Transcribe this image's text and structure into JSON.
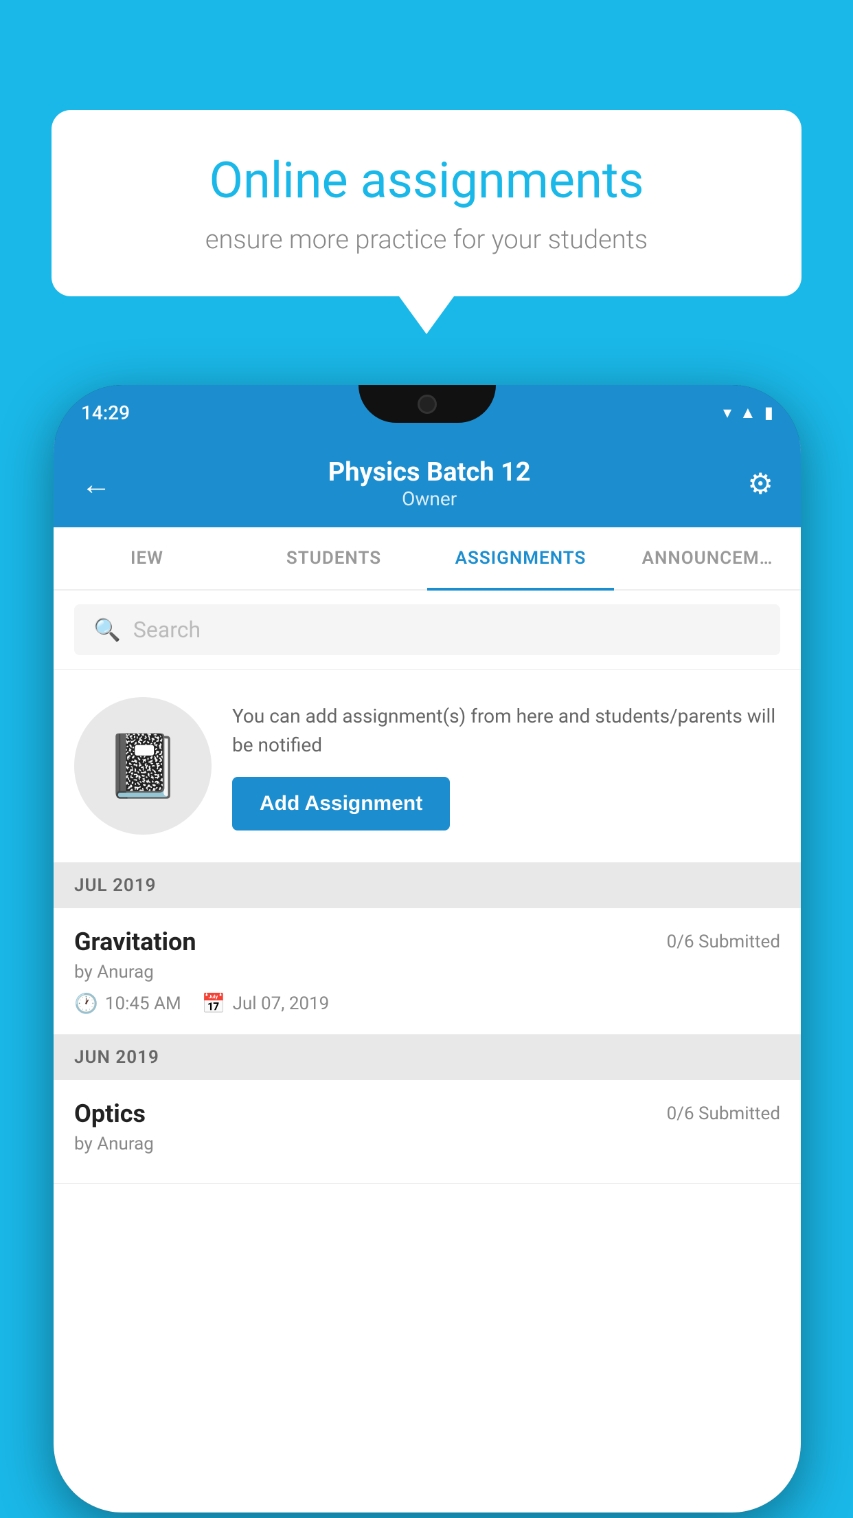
{
  "background_color": "#1ab8e8",
  "speech_bubble": {
    "title": "Online assignments",
    "subtitle": "ensure more practice for your students"
  },
  "phone": {
    "status_bar": {
      "time": "14:29",
      "icons": [
        "wifi",
        "signal",
        "battery"
      ]
    },
    "header": {
      "title": "Physics Batch 12",
      "subtitle": "Owner",
      "back_icon": "←",
      "settings_icon": "⚙"
    },
    "tabs": [
      {
        "label": "IEW",
        "active": false
      },
      {
        "label": "STUDENTS",
        "active": false
      },
      {
        "label": "ASSIGNMENTS",
        "active": true
      },
      {
        "label": "ANNOUNCEM…",
        "active": false
      }
    ],
    "search": {
      "placeholder": "Search"
    },
    "promo": {
      "description": "You can add assignment(s) from here and students/parents will be notified",
      "button_label": "Add Assignment"
    },
    "sections": [
      {
        "month_label": "JUL 2019",
        "assignments": [
          {
            "title": "Gravitation",
            "submitted": "0/6 Submitted",
            "author": "by Anurag",
            "time": "10:45 AM",
            "date": "Jul 07, 2019"
          }
        ]
      },
      {
        "month_label": "JUN 2019",
        "assignments": [
          {
            "title": "Optics",
            "submitted": "0/6 Submitted",
            "author": "by Anurag",
            "time": "",
            "date": ""
          }
        ]
      }
    ]
  }
}
